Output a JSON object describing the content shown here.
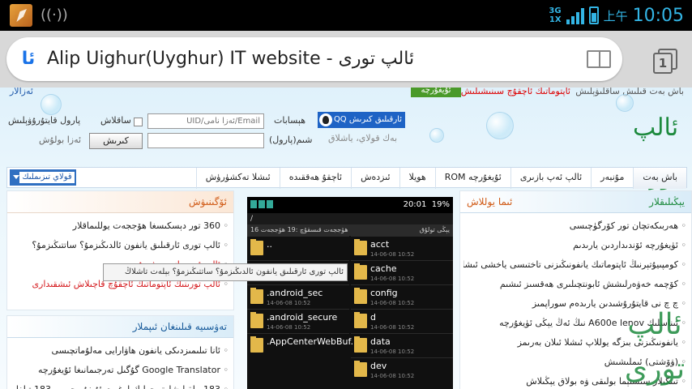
{
  "status_bar": {
    "network_type_top": "3G",
    "network_type_bottom": "1X",
    "time_prefix": "上午",
    "time": "10:05"
  },
  "browser": {
    "favicon_text": "ئا",
    "page_title": "Alip Uighur(Uyghur) IT website - ئالپ تورى",
    "tabs_count": "1"
  },
  "page": {
    "top_strip": {
      "right_text": "باش بەت قىلىش ساقلىۋېلىش",
      "red_text": "ئاپتوماتىك ئاچقۇچ سىنىشىلىش",
      "green_button": "ئۇيغۇرچە",
      "left_text": "ئەزالار"
    },
    "login": {
      "qq_button": "QQ ئارقىلىق كىرىش",
      "qq_sub": "بەك قولاي، ياشلاق",
      "account_label": "ھېسابات",
      "account_placeholder": "UID/ئەزا نامى/Email",
      "remember_label": "ساقلاش",
      "recover_password": "پارول قايتۇرۇۋېلىش",
      "password_label": "شىم(پارول)",
      "login_button": "كىرىش",
      "register_link": "ئەزا بولۇش"
    },
    "nav": {
      "items": [
        "باش بەت",
        "مۇنبەر",
        "ئالپ ئەپ بازىرى",
        "ئۇيغۇرچە ROM",
        "ھويلا",
        "ئىزدەش",
        "ئاچقۇ ھەققىدە",
        "ئىشلا تەكشۈرۈش"
      ],
      "dropdown_label": "قولاي تىزىملىك"
    },
    "right_column": {
      "title": "يېڭىلىقلار",
      "title_sub": "ئىما يوللاش",
      "items": [
        "ھەربىكەتچان تور كۆرگۈچىسى",
        "ئۈيغۇرچە ئۆندىداردىن يارىدىم",
        "كومپىيۇتېرنىڭ ئاپتوماتىك يانفونىڭىزنى تاختىسى ياخشى ئىشلىشمەس",
        "كۆچمە خەۋەرلىشش ئابونتچىلىرى ھەقسىز ئىشىم",
        "چ چ نى قايتۇرۇشىدىن يارىدەم سوراپمىز",
        "ئىناسلىك A600e lenov نىڭ ئەڭ يېڭى ئۈيغۇرچە",
        "يانفونىڭىزنى بىزگە يوللاپ ئىشلا ئىلان بەرىمز",
        "(ۋۆشتى) ئىملىشىش",
        "تىنگىلار سىستېما بولىقى ۋە بولاق يېڭىلاش"
      ]
    },
    "middle_column": {
      "title": "ئۆگىنىۋش",
      "items": [
        {
          "text": "360 تور دېسكىسغا ھۆججەت يوللىماقلار",
          "red": false
        },
        {
          "text": "ئالپ تورى ئارقىلىق يانفون ئالدىڭىزمۇ؟ ساتتىڭىزمۇ؟",
          "red": false
        },
        {
          "text": "ئالپ ئەپ بازىرى فورۇمىدى",
          "red": true
        },
        {
          "text": "ئالپ تورىنىڭ ئاپتوماتىك ئاچقۇچ قاچىلاش ئىشقىدارى",
          "red": true
        }
      ],
      "tooltip": "ئالپ تورى ئارقىلىق يانفون ئالدىڭىزمۇ؟ ساتتىڭىزمۇ؟ بېلەت تاشلاڭ"
    },
    "bottom_left_column": {
      "title": "تەۋسىيە قىلىنغان ئىپملار",
      "items": [
        "ئانا تىلىمىزدىكى يانفون ھاۋارايى مەلۇماتچىسى",
        "Google Translator گۇگىل تەرجىمانىغا ئۇيغۇرچە",
        "183 يىلقىلىشلىق جولىك لوغەت ئۇيغۇر چىرىن 183 تىلغا"
      ]
    },
    "phone_screenshot": {
      "status_time": "20:01",
      "battery": "19%",
      "path": "/",
      "col_name": "16 ھۆججەت قىسقۇچ :19 ھۆججەت",
      "col_date": "يېڭى تولۇق",
      "left_files": [
        {
          "name": "..",
          "date": ""
        },
        {
          "name": ".android",
          "date": "14-05-30 19:27"
        },
        {
          "name": ".android_sec",
          "date": "14-06-08 10:52"
        },
        {
          "name": ".android_secure",
          "date": "14-06-08 10:52"
        },
        {
          "name": ".AppCenterWebBuf...",
          "date": ""
        }
      ],
      "right_files": [
        {
          "name": "acct",
          "date": "14-06-08 10:52"
        },
        {
          "name": "cache",
          "date": "14-06-08 10:52"
        },
        {
          "name": "config",
          "date": "14-06-08 10:52"
        },
        {
          "name": "d",
          "date": "14-06-08 10:52"
        },
        {
          "name": "data",
          "date": "14-06-08 10:52"
        },
        {
          "name": "dev",
          "date": "14-06-08 10:52"
        }
      ]
    },
    "logo_text": "ئالپ تورى",
    "watermark_text": "ئالپ تورى"
  }
}
